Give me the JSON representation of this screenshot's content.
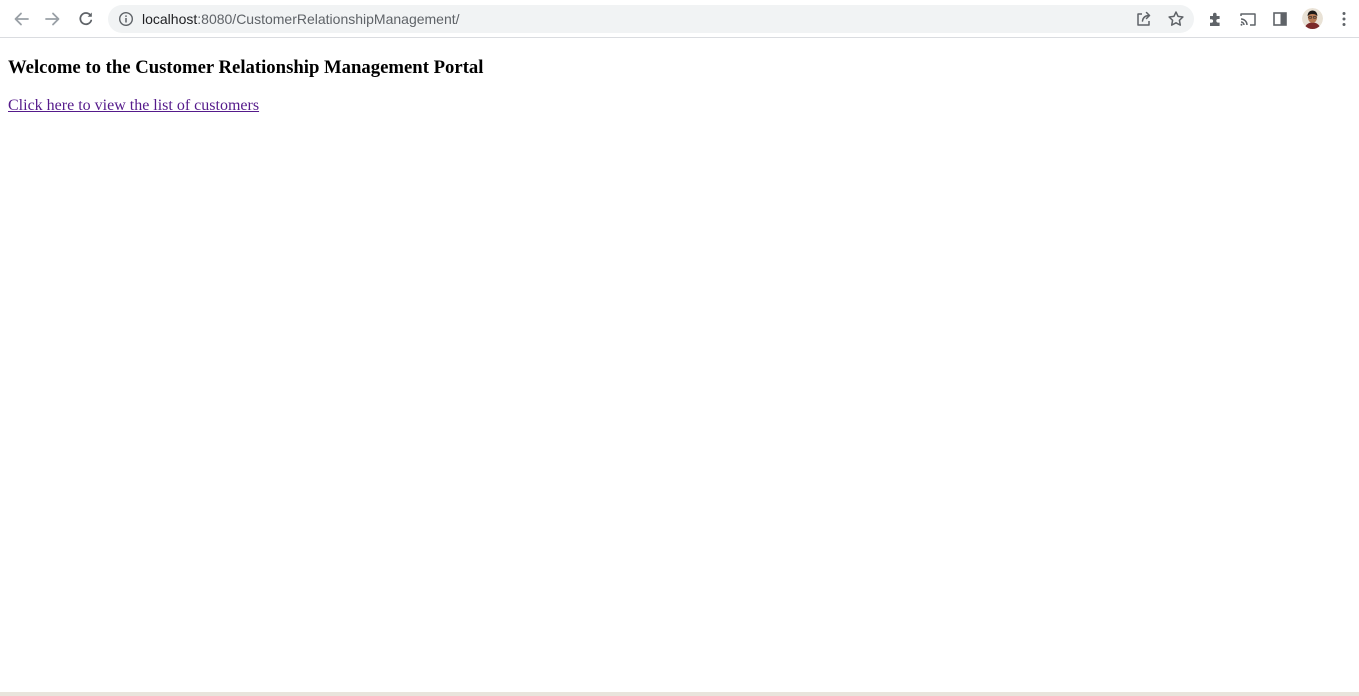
{
  "browser": {
    "url_host": "localhost",
    "url_rest": ":8080/CustomerRelationshipManagement/",
    "icons": {
      "back": "arrow-left-icon",
      "forward": "arrow-right-icon",
      "reload": "reload-icon",
      "site_info": "info-icon",
      "share": "share-icon",
      "bookmark": "star-icon",
      "extensions": "puzzle-icon",
      "cast": "cast-icon",
      "side_panel": "side-panel-icon",
      "menu": "kebab-menu-icon"
    }
  },
  "page": {
    "title": "Welcome to the Customer Relationship Management Portal",
    "link_text": "Click here to view the list of customers",
    "link_color": "#551a8b"
  }
}
